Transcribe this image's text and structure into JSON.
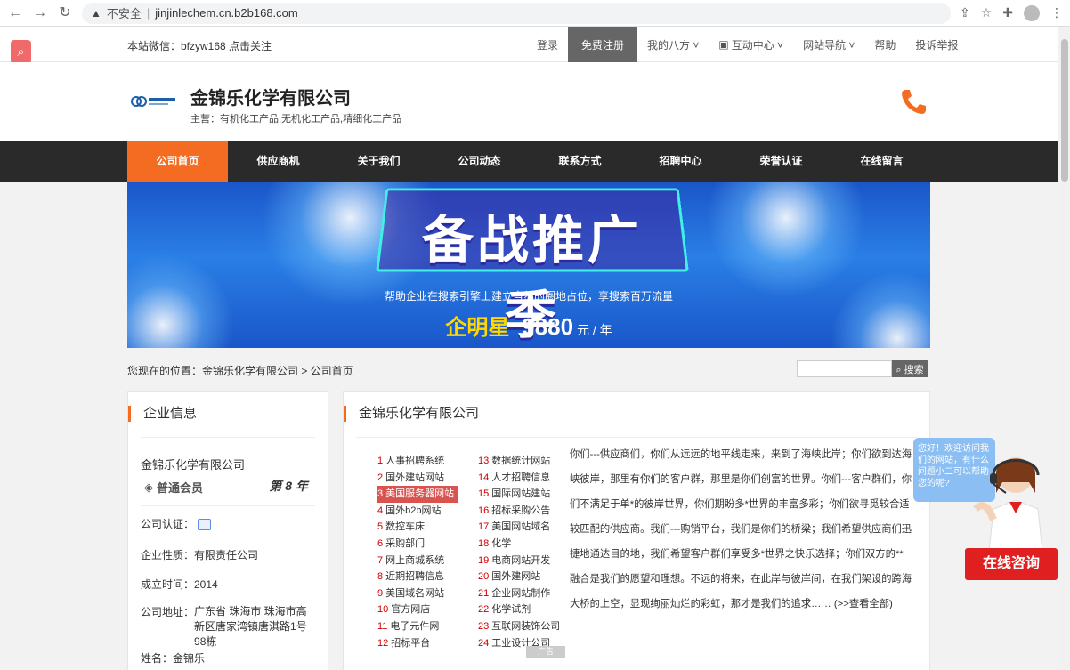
{
  "browser": {
    "insecure_label": "不安全",
    "url": "jinjinlechem.cn.b2b168.com"
  },
  "topbar": {
    "wechat": "本站微信：bfzyw168 点击关注",
    "links": [
      "登录",
      "免费注册",
      "我的八方 ˅",
      "互动中心 ˅",
      "网站导航 ˅",
      "帮助",
      "投诉举报"
    ]
  },
  "header": {
    "company_name": "金锦乐化学有限公司",
    "main_business": "主营：有机化工产品,无机化工产品,精细化工产品"
  },
  "nav": [
    "公司首页",
    "供应商机",
    "关于我们",
    "公司动态",
    "联系方式",
    "招聘中心",
    "荣誉认证",
    "在线留言"
  ],
  "banner": {
    "headline": "备战推广季",
    "sub": "帮助企业在搜索引擎上建立自然的圈地占位，享搜索百万流量",
    "brand": "企明星",
    "amount": "9880",
    "unit": "元 / 年"
  },
  "breadcrumb": "您现在的位置：金锦乐化学有限公司 > 公司首页",
  "search_button": "搜索",
  "left_panel": {
    "title": "企业信息",
    "company": "金锦乐化学有限公司",
    "member": "普通会员",
    "years": "第 8 年",
    "cert_label": "公司认证：",
    "nature": "企业性质：有限责任公司",
    "founded": "成立时间：2014",
    "address_label": "公司地址：",
    "address": "广东省 珠海市 珠海市高新区唐家湾镇唐淇路1号98栋",
    "contact": "姓名：金锦乐"
  },
  "right_panel": {
    "title": "金锦乐化学有限公司",
    "ad_col1": [
      {
        "n": "1",
        "t": "人事招聘系统"
      },
      {
        "n": "2",
        "t": "国外建站网站"
      },
      {
        "n": "3",
        "t": "美国服务器网站"
      },
      {
        "n": "4",
        "t": "国外b2b网站"
      },
      {
        "n": "5",
        "t": "数控车床"
      },
      {
        "n": "6",
        "t": "采购部门"
      },
      {
        "n": "7",
        "t": "网上商城系统"
      },
      {
        "n": "8",
        "t": "近期招聘信息"
      },
      {
        "n": "9",
        "t": "美国域名网站"
      },
      {
        "n": "10",
        "t": "官方网店"
      },
      {
        "n": "11",
        "t": "电子元件网"
      },
      {
        "n": "12",
        "t": "招标平台"
      }
    ],
    "ad_col2": [
      {
        "n": "13",
        "t": "数据统计网站"
      },
      {
        "n": "14",
        "t": "人才招聘信息"
      },
      {
        "n": "15",
        "t": "国际网站建站"
      },
      {
        "n": "16",
        "t": "招标采购公告"
      },
      {
        "n": "17",
        "t": "美国网站域名"
      },
      {
        "n": "18",
        "t": "化学"
      },
      {
        "n": "19",
        "t": "电商网站开发"
      },
      {
        "n": "20",
        "t": "国外建网站"
      },
      {
        "n": "21",
        "t": "企业网站制作"
      },
      {
        "n": "22",
        "t": "化学试剂"
      },
      {
        "n": "23",
        "t": "互联网装饰公司"
      },
      {
        "n": "24",
        "t": "工业设计公司"
      }
    ],
    "ad_badge": "广告",
    "intro": "你们---供应商们，你们从远远的地平线走来，来到了海峡此岸；你们欲到达海峡彼岸，那里有你们的客户群，那里是你们创富的世界。你们---客户群们，你们不满足于单*的彼岸世界，你们期盼多*世界的丰富多彩；你们欲寻觅较合适较匹配的供应商。我们---购销平台，我们是你们的桥梁；我们希望供应商们迅捷地通达目的地，我们希望客户群们享受多*世界之快乐选择；你们双方的**融合是我们的愿望和理想。不远的将来，在此岸与彼岸间，在我们架设的跨海大桥的上空，显现绚丽灿烂的彩虹，那才是我们的追求……  (>>查看全部)"
  },
  "chat": {
    "bubble": "您好！欢迎访问我们的网站，有什么问题小二可以帮助您的呢?",
    "button": "在线咨询"
  },
  "colors": {
    "accent": "#f36c21",
    "nav_bg": "#2a2a2a",
    "chat_red": "#e02020"
  }
}
